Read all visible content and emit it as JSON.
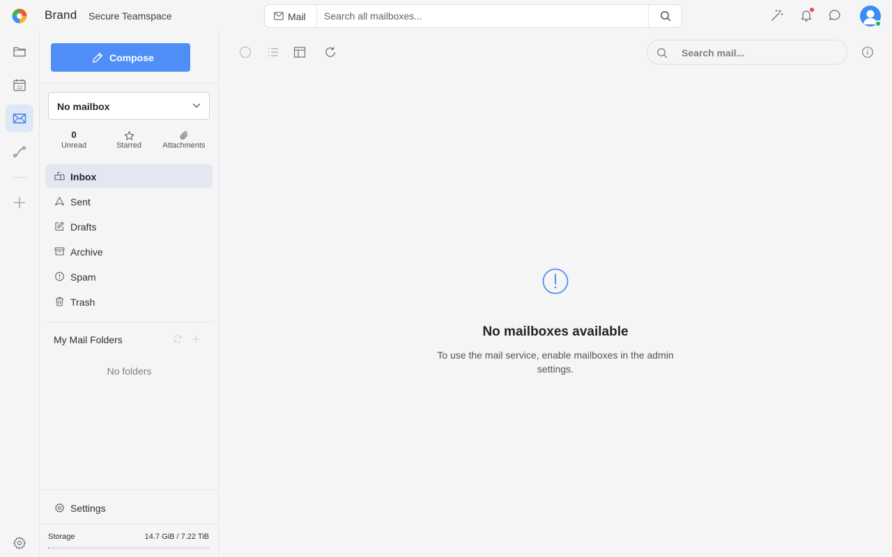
{
  "header": {
    "brand": "Brand",
    "teamspace": "Secure Teamspace",
    "search_scope": "Mail",
    "search_placeholder": "Search all mailboxes...",
    "icons": [
      "magic-wand-icon",
      "bell-icon",
      "chat-icon",
      "avatar"
    ],
    "has_notification": true
  },
  "rail": {
    "items": [
      "files",
      "calendar",
      "mail",
      "workflows",
      "add"
    ],
    "active": "mail",
    "calendar_day": "12"
  },
  "sidebar": {
    "compose_label": "Compose",
    "mailbox_select": "No mailbox",
    "stats": {
      "unread_count": "0",
      "unread_label": "Unread",
      "starred_label": "Starred",
      "attachments_label": "Attachments"
    },
    "folders": [
      {
        "label": "Inbox",
        "icon": "inbox-icon",
        "active": true
      },
      {
        "label": "Sent",
        "icon": "sent-icon",
        "active": false
      },
      {
        "label": "Drafts",
        "icon": "drafts-icon",
        "active": false
      },
      {
        "label": "Archive",
        "icon": "archive-icon",
        "active": false
      },
      {
        "label": "Spam",
        "icon": "spam-icon",
        "active": false
      },
      {
        "label": "Trash",
        "icon": "trash-icon",
        "active": false
      }
    ],
    "my_folders_title": "My Mail Folders",
    "no_folders": "No folders",
    "settings_label": "Settings",
    "storage_label": "Storage",
    "storage_value": "14.7 GiB / 7.22 TiB",
    "storage_used_fraction": 0.002
  },
  "main": {
    "search_placeholder": "Search mail...",
    "empty_title": "No mailboxes available",
    "empty_desc": "To use the mail service, enable mailboxes in the admin settings."
  },
  "colors": {
    "accent": "#4f8ef7",
    "active_rail": "#dde7f5",
    "notification": "#f0444e",
    "online": "#22b35e"
  }
}
